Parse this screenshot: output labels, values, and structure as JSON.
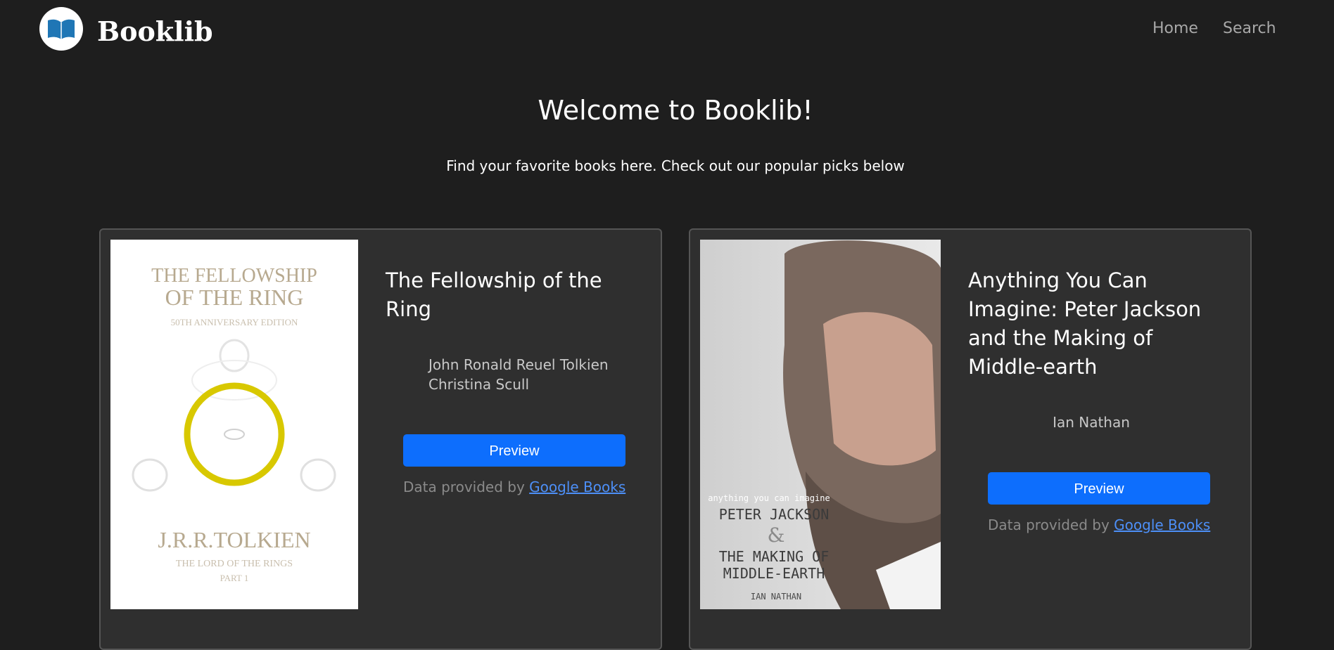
{
  "nav": {
    "brand": "Booklib",
    "links": [
      "Home",
      "Search"
    ]
  },
  "hero": {
    "title": "Welcome to Booklib!",
    "subtitle": "Find your favorite books here. Check out our popular picks below"
  },
  "books": [
    {
      "title": "The Fellowship of the Ring",
      "authors": [
        "John Ronald Reuel Tolkien",
        "Christina Scull"
      ],
      "preview_label": "Preview",
      "provided_prefix": "Data provided by",
      "provided_link": "Google Books",
      "cover": {
        "line1": "THE FELLOWSHIP",
        "line2": "OF THE RING",
        "line3": "50TH ANNIVERSARY EDITION",
        "author": "J.R.R.TOLKIEN",
        "series": "THE LORD OF THE RINGS",
        "part": "PART 1"
      }
    },
    {
      "title": "Anything You Can Imagine: Peter Jackson and the Making of Middle-earth",
      "authors": [
        "Ian Nathan"
      ],
      "preview_label": "Preview",
      "provided_prefix": "Data provided by",
      "provided_link": "Google Books",
      "cover": {
        "line1": "anything you can imagine",
        "line2": "PETER JACKSON",
        "line3": "&",
        "line4": "THE MAKING OF",
        "line5": "MIDDLE-EARTH",
        "author": "IAN NATHAN"
      }
    }
  ],
  "colors": {
    "background": "#1e1e1e",
    "card": "#2f2f2f",
    "button": "#0d6efd",
    "link": "#4d8ff7"
  }
}
